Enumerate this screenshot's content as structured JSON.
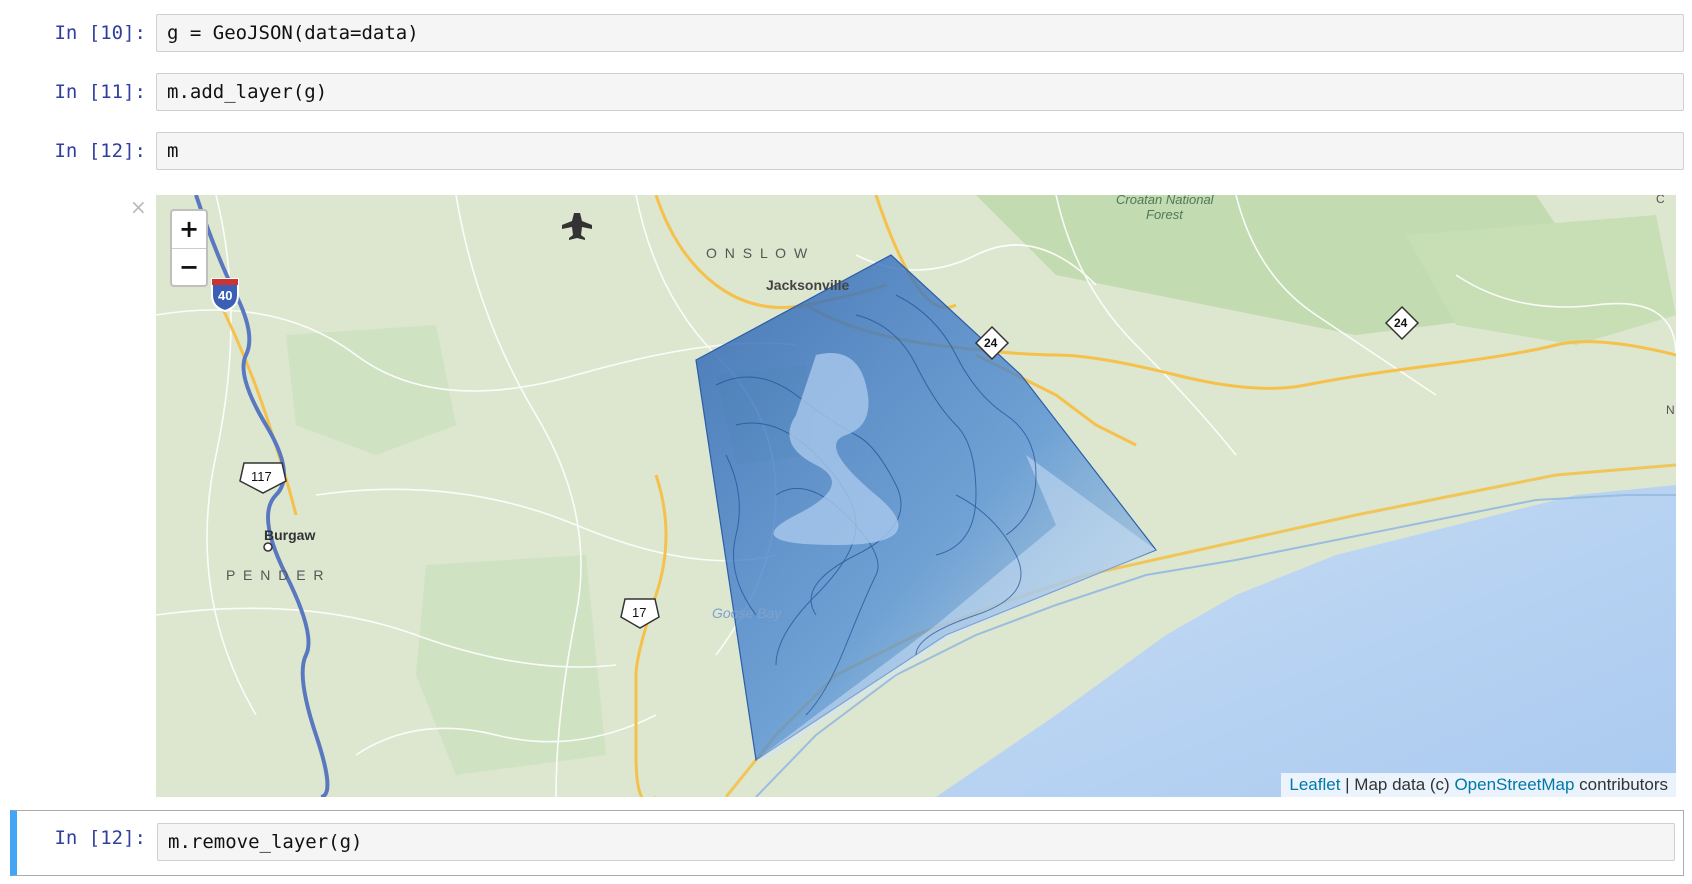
{
  "cells": [
    {
      "prompt": "In [10]:",
      "code": "g = GeoJSON(data=data)"
    },
    {
      "prompt": "In [11]:",
      "code": "m.add_layer(g)"
    },
    {
      "prompt": "In [12]:",
      "code": "m"
    },
    {
      "prompt": "In [12]:",
      "code": "m.remove_layer(g)"
    }
  ],
  "output": {
    "close_label": "×",
    "zoom_in": "+",
    "zoom_out": "−",
    "attribution": {
      "leaflet": "Leaflet",
      "separator": " | Map data (c) ",
      "osm": "OpenStreetMap",
      "suffix": " contributors"
    },
    "map_labels": {
      "onslow": "O N S L O W",
      "jacksonville": "Jacksonville",
      "croatan": "Croatan National",
      "forest": "Forest",
      "burgaw": "Burgaw",
      "pender": "P E N D E R",
      "goose_bay": "Goose Bay",
      "edge_c": "C",
      "edge_n": "N",
      "shield_40": "40",
      "shield_117": "117",
      "shield_17": "17",
      "shield_24a": "24",
      "shield_24b": "24"
    }
  },
  "colors": {
    "prompt": "#303F9F",
    "active_border": "#42A5F5",
    "water": "#b5d0f0",
    "land": "#dde6cf",
    "forest": "#c4dcb3",
    "highway": "#f5c14b",
    "interstate": "#5a78c0",
    "overlay": "#3a78c8"
  }
}
